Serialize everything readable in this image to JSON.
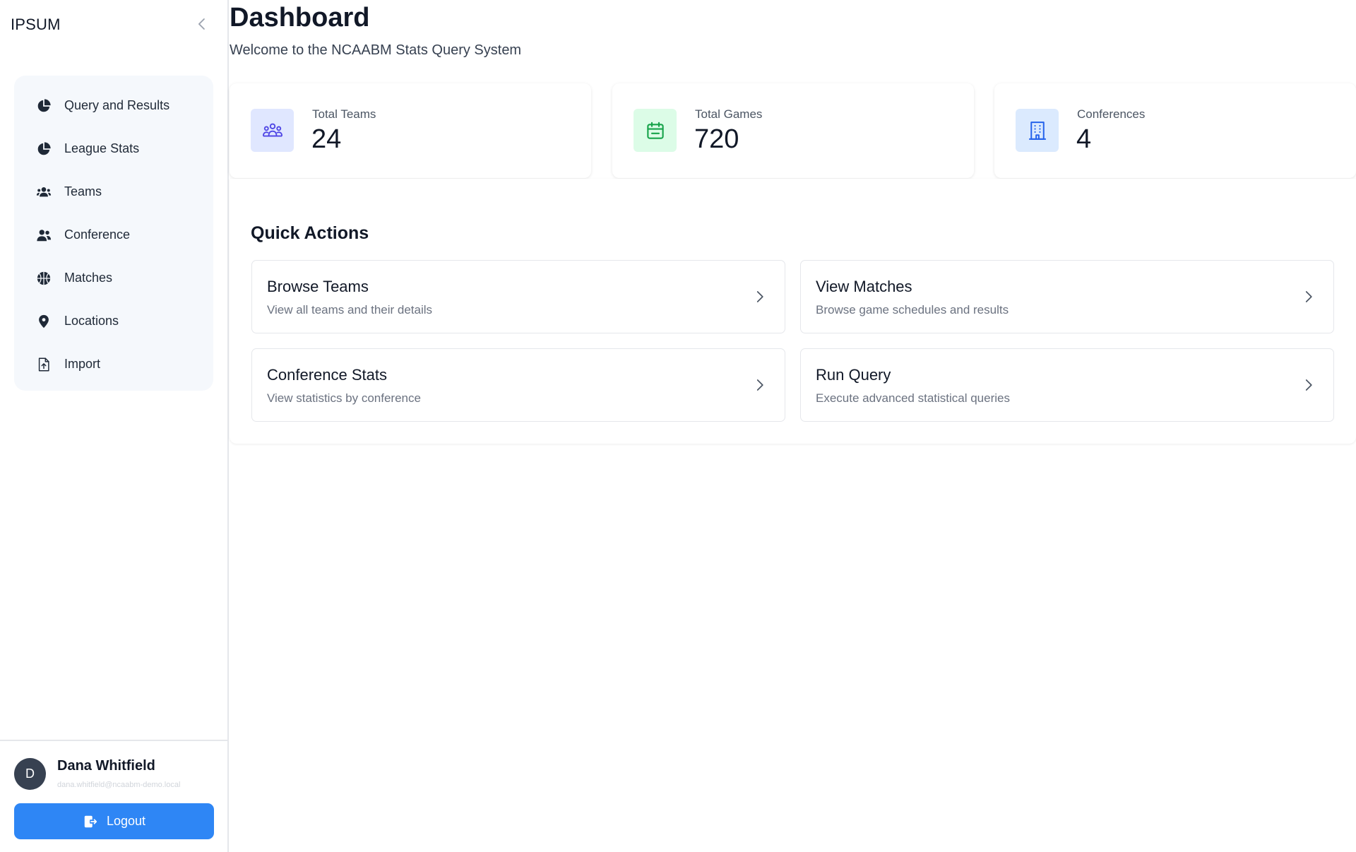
{
  "app": {
    "brand": "IPSUM"
  },
  "sidebar": {
    "items": [
      {
        "label": "Query and Results",
        "icon": "pie-chart-icon"
      },
      {
        "label": "League Stats",
        "icon": "pie-chart-icon"
      },
      {
        "label": "Teams",
        "icon": "users-icon"
      },
      {
        "label": "Conference",
        "icon": "user-group-icon"
      },
      {
        "label": "Matches",
        "icon": "basketball-icon"
      },
      {
        "label": "Locations",
        "icon": "map-pin-icon"
      },
      {
        "label": "Import",
        "icon": "file-upload-icon"
      }
    ]
  },
  "user": {
    "initial": "D",
    "name": "Dana Whitfield",
    "email": "dana.whitfield@ncaabm-demo.local",
    "logout_label": "Logout"
  },
  "header": {
    "title": "Dashboard",
    "subtitle": "Welcome to the NCAABM Stats Query System"
  },
  "stats": [
    {
      "label": "Total Teams",
      "value": "24",
      "icon": "team-icon",
      "icon_bg": "#e0e7ff",
      "icon_color": "#4f46e5"
    },
    {
      "label": "Total Games",
      "value": "720",
      "icon": "calendar-icon",
      "icon_bg": "#dcfce7",
      "icon_color": "#16a34a"
    },
    {
      "label": "Conferences",
      "value": "4",
      "icon": "building-icon",
      "icon_bg": "#dbeafe",
      "icon_color": "#2563eb"
    }
  ],
  "quick_actions": {
    "title": "Quick Actions",
    "items": [
      {
        "title": "Browse Teams",
        "desc": "View all teams and their details"
      },
      {
        "title": "View Matches",
        "desc": "Browse game schedules and results"
      },
      {
        "title": "Conference Stats",
        "desc": "View statistics by conference"
      },
      {
        "title": "Run Query",
        "desc": "Execute advanced statistical queries"
      }
    ]
  },
  "colors": {
    "accent": "#2e86f5",
    "sidebar_panel": "#f5f8fc"
  }
}
